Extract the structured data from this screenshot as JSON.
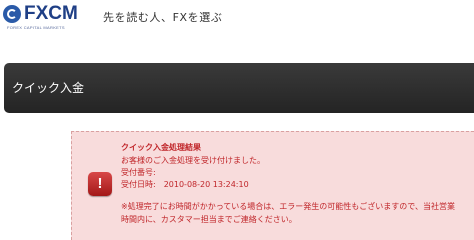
{
  "header": {
    "logo_text": "FXCM",
    "logo_subtext": "FOREX CAPITAL MARKETS",
    "tagline": "先を読む人、FXを選ぶ"
  },
  "titlebar": {
    "title": "クイック入金"
  },
  "panel": {
    "icon": "exclamation-icon",
    "title": "クイック入金処理結果",
    "lines": [
      "お客様のご入金処理を受け付けました。",
      "受付番号:",
      "受付日時:　2010-08-20 13:24:10"
    ],
    "note_lines": [
      "※処理完了にお時間がかかっている場合は、エラー発生の可能性もございますので、当社営業",
      "時間内に、カスタマー担当までご連絡ください。"
    ]
  },
  "colors": {
    "brand": "#1f3f86",
    "titlebar_bg": "#2e2e2e",
    "alert_bg": "#f8dcdc",
    "alert_text": "#c0262a"
  }
}
